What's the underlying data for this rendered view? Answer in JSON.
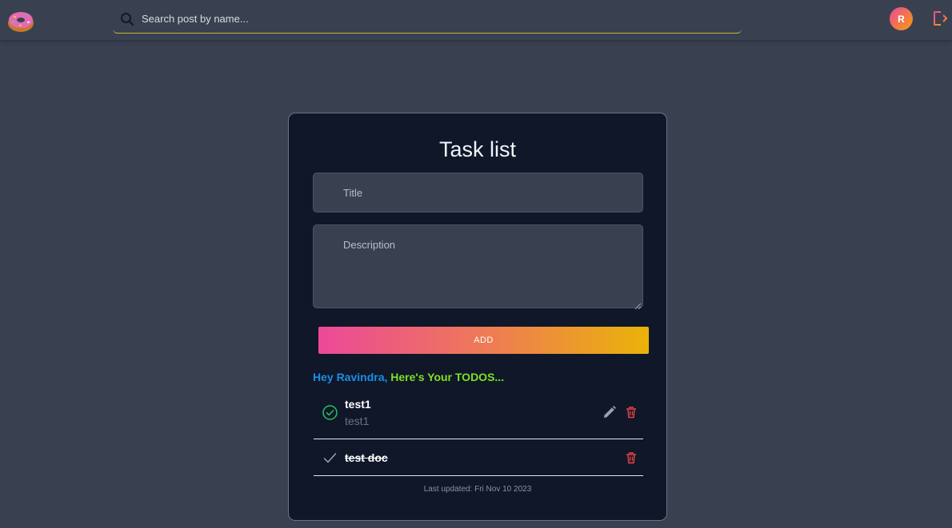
{
  "header": {
    "logo_icon": "donut-icon",
    "search": {
      "placeholder": "Search post by name...",
      "value": ""
    },
    "avatar_initial": "R",
    "logout_icon": "logout-icon"
  },
  "card": {
    "title": "Task list",
    "form": {
      "title_placeholder": "Title",
      "description_placeholder": "Description",
      "add_label": "ADD"
    },
    "greeting": {
      "name_part": "Hey Ravindra,",
      "rest_part": " Here's Your TODOS..."
    },
    "todos": [
      {
        "title": "test1",
        "description": "test1",
        "completed": false,
        "editable": true
      },
      {
        "title": "test doc",
        "description": "",
        "completed": true,
        "editable": false
      }
    ],
    "last_updated": "Last updated: Fri Nov 10 2023"
  },
  "colors": {
    "page_bg": "#394151",
    "card_bg": "#0f1729",
    "accent_pink": "#ec4899",
    "accent_yellow": "#eab308",
    "greet_blue": "#1a8fe3",
    "greet_green": "#7ee11f",
    "check_green": "#22c55e",
    "delete_red": "#ef4444"
  }
}
